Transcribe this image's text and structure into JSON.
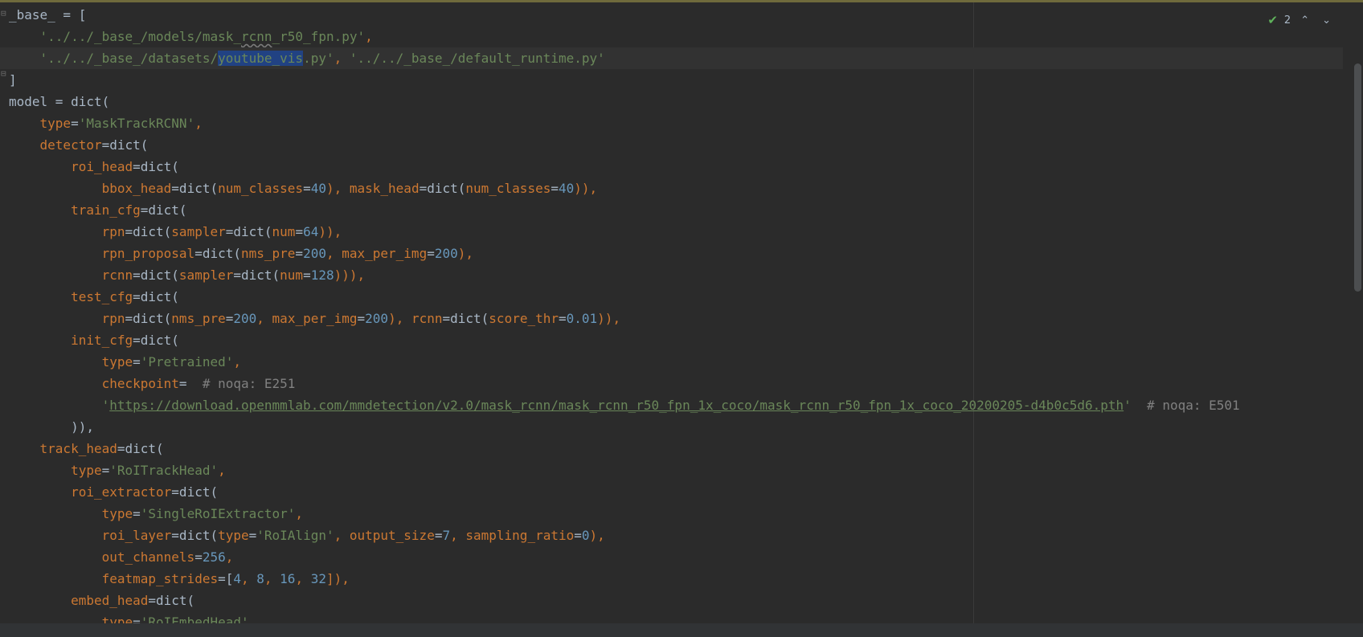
{
  "inspection": {
    "count": "2",
    "up_icon": "chevron-up-icon",
    "down_icon": "chevron-down-icon",
    "status_icon": "check-icon"
  },
  "code": {
    "l1": {
      "a": "_base_ = ["
    },
    "l2": {
      "a": "    ",
      "s1": "'../../_base_/models/mask_",
      "s2": "rcnn",
      "s3": "_r50_fpn.py'",
      "p": ","
    },
    "l3": {
      "a": "    ",
      "s1": "'../../_base_/datasets/",
      "sel": "youtube_vis",
      "s2": ".py'",
      "p": ", ",
      "s3": "'../../_base_/default_runtime.py'"
    },
    "l4": {
      "a": "]"
    },
    "l5": {
      "a": "model = dict("
    },
    "l6": {
      "a": "    ",
      "k": "type",
      "e": "=",
      "s": "'MaskTrackRCNN'",
      "p": ","
    },
    "l7": {
      "a": "    ",
      "k": "detector",
      "e": "=dict("
    },
    "l8": {
      "a": "        ",
      "k": "roi_head",
      "e": "=dict("
    },
    "l9": {
      "a": "            ",
      "k1": "bbox_head",
      "e1": "=dict(",
      "k2": "num_classes",
      "e2": "=",
      "n1": "40",
      "c1": "), ",
      "k3": "mask_head",
      "e3": "=dict(",
      "k4": "num_classes",
      "e4": "=",
      "n2": "40",
      "c2": ")),"
    },
    "l10": {
      "a": "        ",
      "k": "train_cfg",
      "e": "=dict("
    },
    "l11": {
      "a": "            ",
      "k1": "rpn",
      "e1": "=dict(",
      "k2": "sampler",
      "e2": "=dict(",
      "k3": "num",
      "e3": "=",
      "n": "64",
      "c": ")),"
    },
    "l12": {
      "a": "            ",
      "k1": "rpn_proposal",
      "e1": "=dict(",
      "k2": "nms_pre",
      "e2": "=",
      "n1": "200",
      "c1": ", ",
      "k3": "max_per_img",
      "e3": "=",
      "n2": "200",
      "c2": "),"
    },
    "l13": {
      "a": "            ",
      "k1": "rcnn",
      "e1": "=dict(",
      "k2": "sampler",
      "e2": "=dict(",
      "k3": "num",
      "e3": "=",
      "n": "128",
      "c": "))),"
    },
    "l14": {
      "a": "        ",
      "k": "test_cfg",
      "e": "=dict("
    },
    "l15": {
      "a": "            ",
      "k1": "rpn",
      "e1": "=dict(",
      "k2": "nms_pre",
      "e2": "=",
      "n1": "200",
      "c1": ", ",
      "k3": "max_per_img",
      "e3": "=",
      "n2": "200",
      "c2": "), ",
      "k4": "rcnn",
      "e4": "=dict(",
      "k5": "score_thr",
      "e5": "=",
      "n3": "0.01",
      "c3": ")),"
    },
    "l16": {
      "a": "        ",
      "k": "init_cfg",
      "e": "=dict("
    },
    "l17": {
      "a": "            ",
      "k": "type",
      "e": "=",
      "s": "'Pretrained'",
      "p": ","
    },
    "l18": {
      "a": "            ",
      "k": "checkpoint",
      "e": "=",
      "cm": "  # noqa: E251"
    },
    "l19": {
      "a": "            ",
      "q1": "'",
      "url": "https://download.openmmlab.com/mmdetection/v2.0/mask_rcnn/mask_rcnn_r50_fpn_1x_coco/mask_rcnn_r50_fpn_1x_coco_20200205-d4b0c5d6.pth",
      "q2": "'",
      "cm": "  # noqa: E501"
    },
    "l20": {
      "a": "        ",
      "c": ")),"
    },
    "l21": {
      "a": "    ",
      "k": "track_head",
      "e": "=dict("
    },
    "l22": {
      "a": "        ",
      "k": "type",
      "e": "=",
      "s": "'RoITrackHead'",
      "p": ","
    },
    "l23": {
      "a": "        ",
      "k": "roi_extractor",
      "e": "=dict("
    },
    "l24": {
      "a": "            ",
      "k": "type",
      "e": "=",
      "s": "'SingleRoIExtractor'",
      "p": ","
    },
    "l25": {
      "a": "            ",
      "k1": "roi_layer",
      "e1": "=dict(",
      "k2": "type",
      "e2": "=",
      "s": "'RoIAlign'",
      "c1": ", ",
      "k3": "output_size",
      "e3": "=",
      "n1": "7",
      "c2": ", ",
      "k4": "sampling_ratio",
      "e4": "=",
      "n2": "0",
      "c3": "),"
    },
    "l26": {
      "a": "            ",
      "k": "out_channels",
      "e": "=",
      "n": "256",
      "p": ","
    },
    "l27": {
      "a": "            ",
      "k": "featmap_strides",
      "e": "=[",
      "n1": "4",
      "c1": ", ",
      "n2": "8",
      "c2": ", ",
      "n3": "16",
      "c3": ", ",
      "n4": "32",
      "c4": "]),"
    },
    "l28": {
      "a": "        ",
      "k": "embed_head",
      "e": "=dict("
    },
    "l29": {
      "a": "            ",
      "k": "type",
      "e": "=",
      "s": "'RoIEmbedHead'",
      "p": ","
    }
  }
}
